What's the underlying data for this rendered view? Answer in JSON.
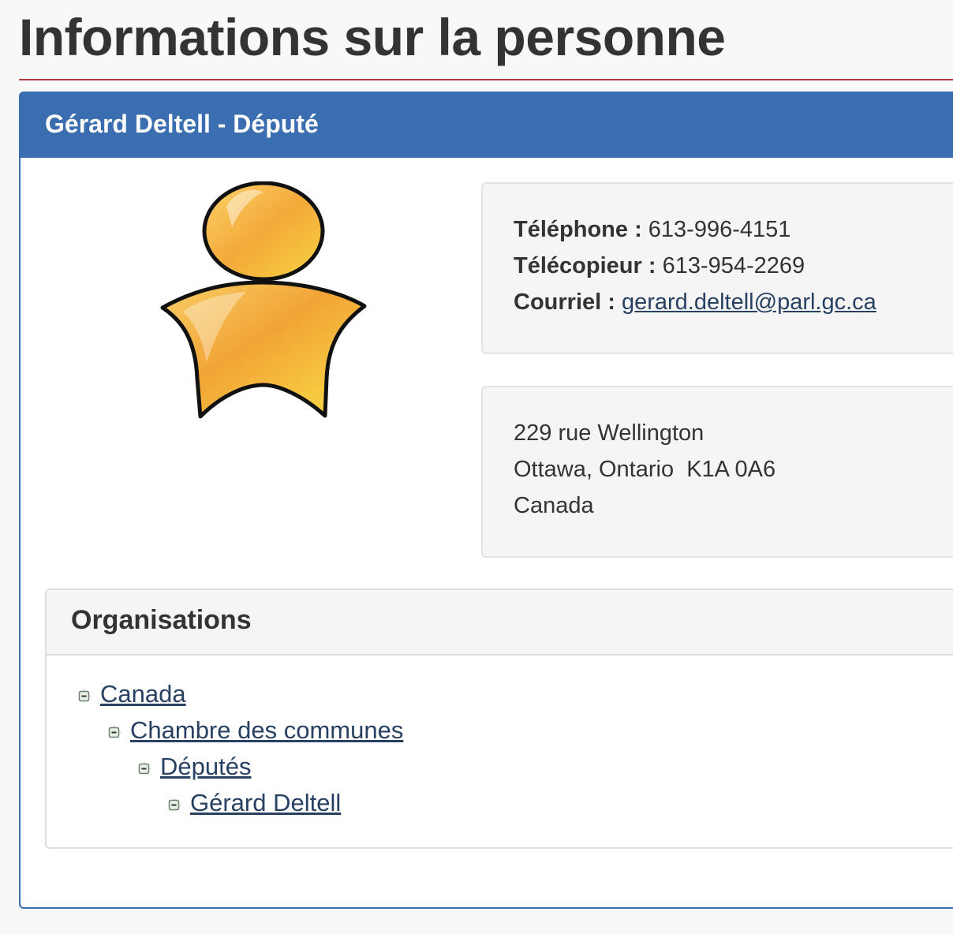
{
  "page": {
    "title": "Informations sur la personne"
  },
  "person": {
    "header": "Gérard Deltell - Député",
    "contact": {
      "phone_label": "Téléphone :",
      "phone": "613-996-4151",
      "fax_label": "Télécopieur :",
      "fax": "613-954-2269",
      "email_label": "Courriel :",
      "email": "gerard.deltell@parl.gc.ca"
    },
    "address": {
      "line1": "229 rue Wellington",
      "line2": "Ottawa, Ontario  K1A 0A6",
      "line3": "Canada"
    }
  },
  "organisations": {
    "title": "Organisations",
    "tree": [
      {
        "label": "Canada",
        "level": 0
      },
      {
        "label": "Chambre des communes",
        "level": 1
      },
      {
        "label": "Députés",
        "level": 2
      },
      {
        "label": "Gérard Deltell",
        "level": 3
      }
    ]
  },
  "colors": {
    "header_blue": "#3b6eb0",
    "title_rule": "#af3c43",
    "link": "#284162",
    "avatar": "#f6b93b"
  },
  "icons": {
    "avatar": "person-avatar-icon",
    "tree_toggle": "collapse-minus-icon"
  }
}
